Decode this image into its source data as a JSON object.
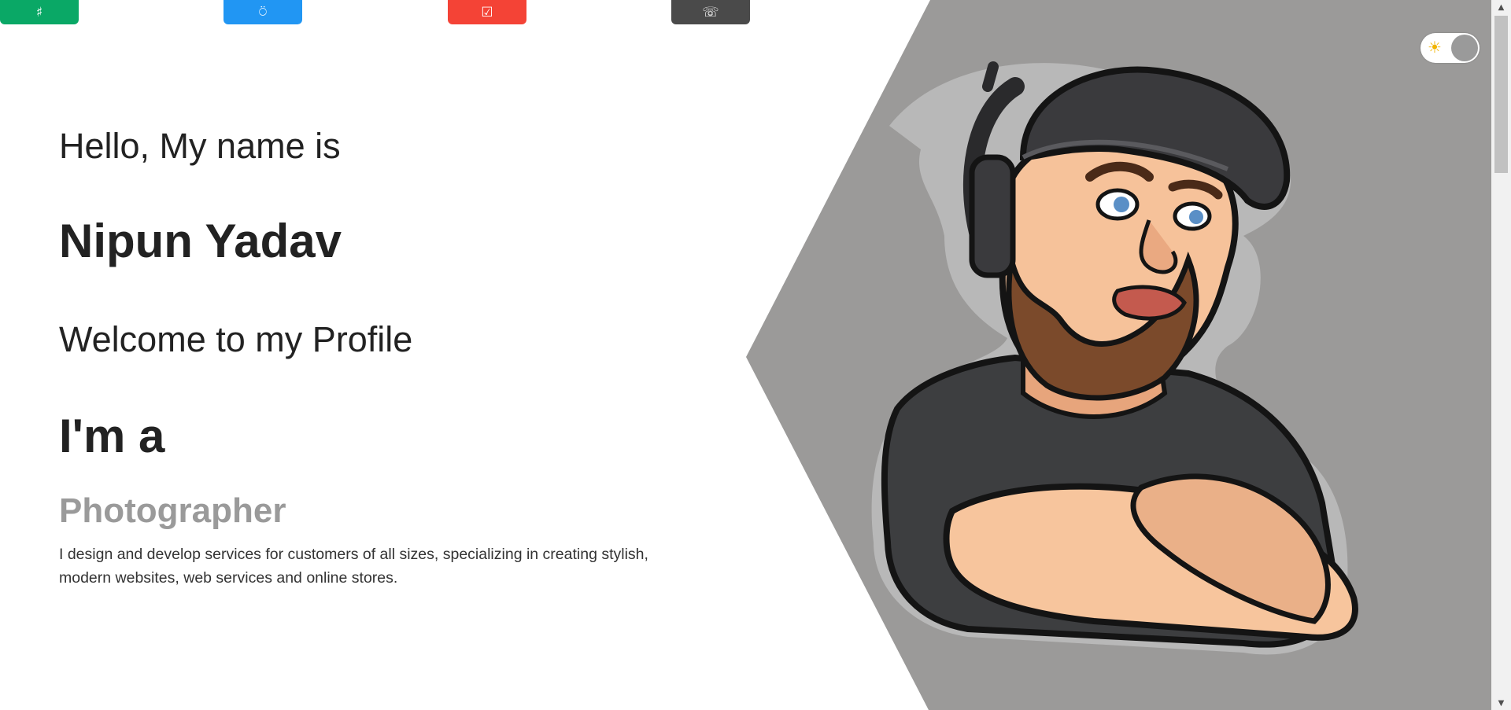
{
  "nav": {
    "tabs": [
      {
        "icon": "♯",
        "icon_name": "hash-icon",
        "color": "#0aa866"
      },
      {
        "icon": "⍥",
        "icon_name": "profile-icon",
        "color": "#2196f3"
      },
      {
        "icon": "☑",
        "icon_name": "checkbox-icon",
        "color": "#f44336"
      },
      {
        "icon": "☏",
        "icon_name": "phone-icon",
        "color": "#4a4a4a"
      }
    ]
  },
  "hero": {
    "greeting": "Hello, My name is",
    "name": "Nipun Yadav",
    "welcome": "Welcome to my Profile",
    "intro": "I'm a",
    "role": "Photographer",
    "description": "I design and develop services for customers of all sizes, specializing in creating stylish, modern websites, web services and online stores."
  },
  "theme_toggle": {
    "icon": "☀",
    "icon_name": "sun-icon"
  },
  "colors": {
    "panel": "#9b9a99",
    "role_text": "#9a9a9a",
    "text": "#222222"
  }
}
